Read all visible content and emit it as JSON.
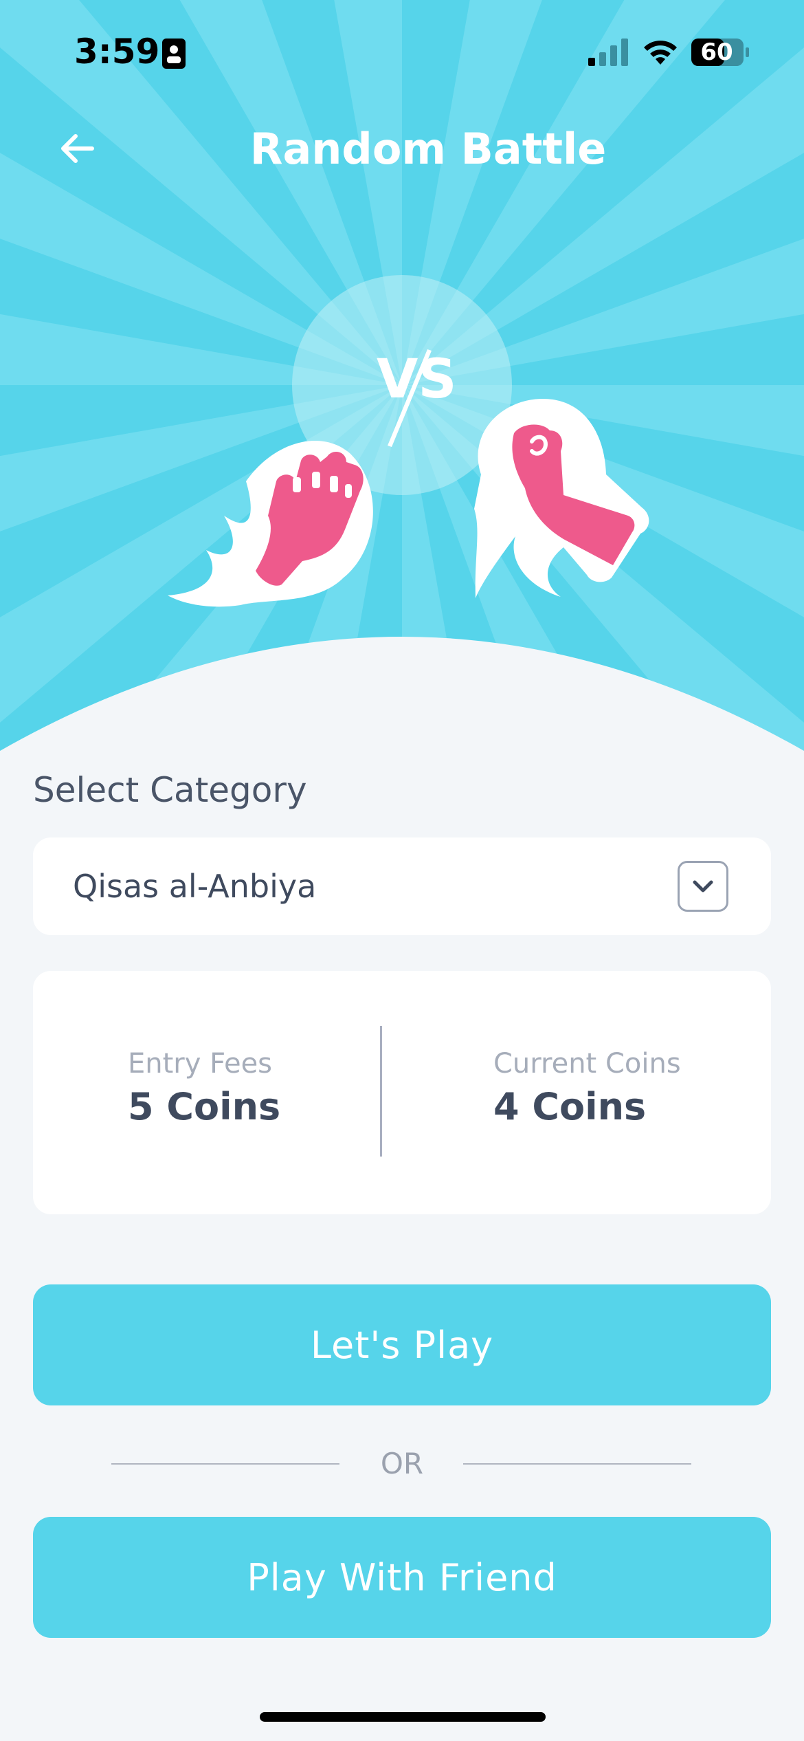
{
  "status_bar": {
    "time": "3:59",
    "battery": "60"
  },
  "header": {
    "title": "Random Battle",
    "back_icon": "arrow-left-icon"
  },
  "hero": {
    "vs_text": "VS",
    "left_icon": "flaming-fist-icon",
    "right_icon": "raised-fist-icon"
  },
  "category": {
    "label": "Select Category",
    "selected": "Qisas al-Anbiya",
    "chevron_icon": "chevron-down-icon"
  },
  "coins": {
    "entry_label": "Entry Fees",
    "entry_value": "5 Coins",
    "current_label": "Current Coins",
    "current_value": "4 Coins"
  },
  "actions": {
    "play_label": "Let's Play",
    "or_text": "OR",
    "friend_label": "Play With Friend"
  },
  "colors": {
    "accent": "#56d4ea",
    "pink": "#ee5a8c",
    "background": "#f3f6f9",
    "text": "#3f4a5e"
  }
}
